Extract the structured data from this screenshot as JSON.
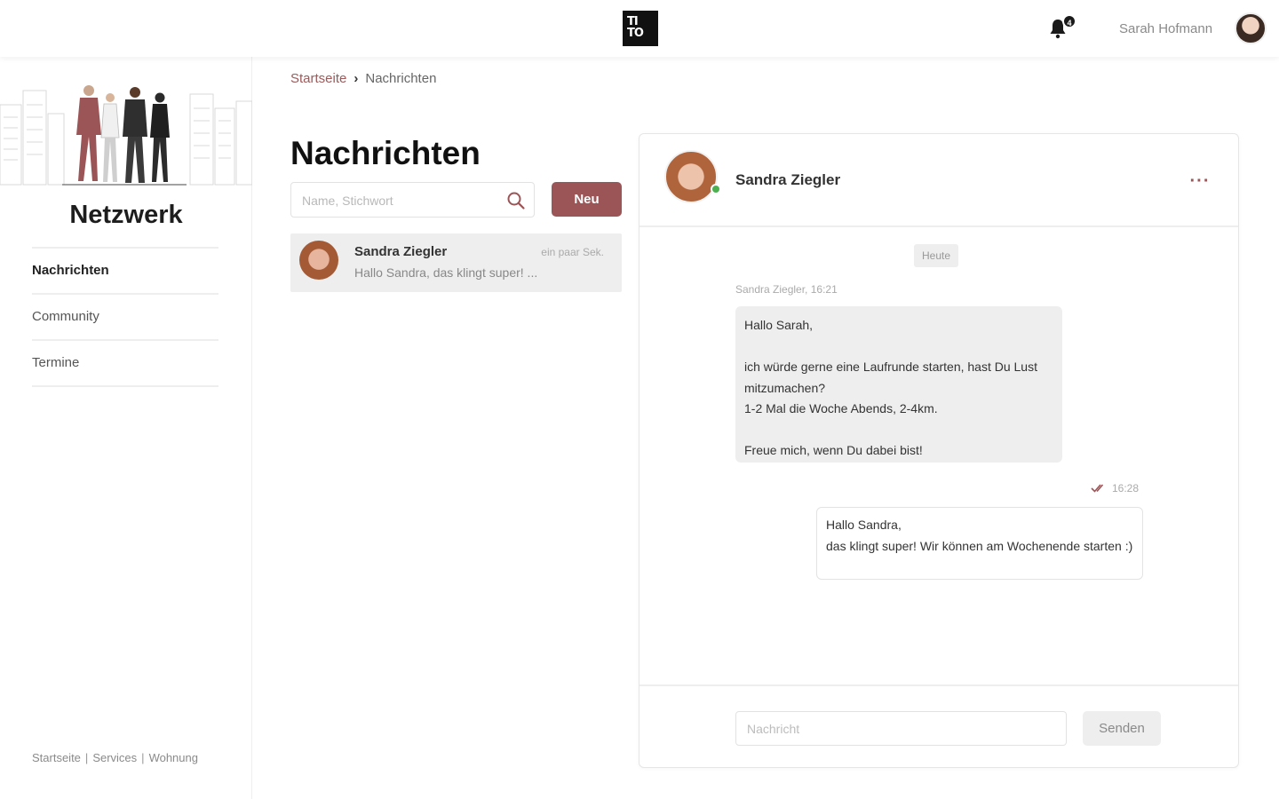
{
  "header": {
    "logo_line1": "TI",
    "logo_line2": "TO",
    "notification_count": "4",
    "user_name": "Sarah Hofmann"
  },
  "sidebar": {
    "title": "Netzwerk",
    "items": [
      {
        "label": "Nachrichten",
        "active": true
      },
      {
        "label": "Community",
        "active": false
      },
      {
        "label": "Termine",
        "active": false
      }
    ],
    "footer_links": [
      "Startseite",
      "Services",
      "Wohnung"
    ],
    "footer_separator": "|"
  },
  "breadcrumb": {
    "home": "Startseite",
    "current": "Nachrichten"
  },
  "messages_page": {
    "title": "Nachrichten",
    "search_placeholder": "Name, Stichwort",
    "new_button": "Neu"
  },
  "conversations": [
    {
      "name": "Sandra Ziegler",
      "time": "ein paar Sek.",
      "preview": "Hallo Sandra, das klingt super! ..."
    }
  ],
  "chat": {
    "contact_name": "Sandra Ziegler",
    "more_label": "···",
    "day_label": "Heute",
    "incoming_meta": "Sandra Ziegler, 16:21",
    "incoming_text": "Hallo Sarah,\n\nich würde gerne eine Laufrunde starten, hast Du Lust mitzumachen?\n1-2 Mal die Woche Abends, 2-4km.\n\nFreue mich, wenn Du dabei bist!",
    "outgoing_time": "16:28",
    "outgoing_text": "Hallo Sandra,\ndas klingt super! Wir können am Wochenende starten :)",
    "input_placeholder": "Nachricht",
    "send_button": "Senden"
  },
  "colors": {
    "accent": "#9b5557",
    "online": "#4caf50",
    "bubble_incoming": "#eeeeee"
  }
}
